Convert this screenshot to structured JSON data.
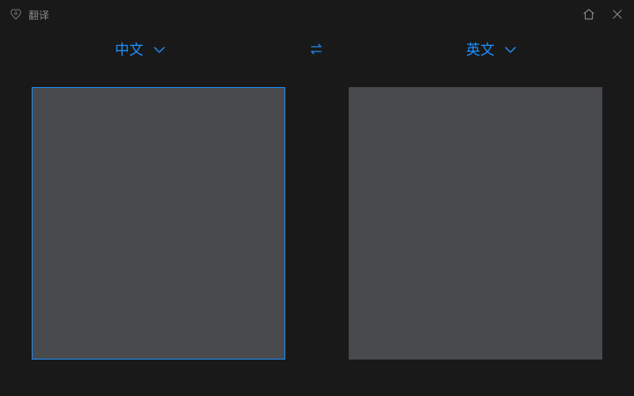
{
  "titlebar": {
    "app_title": "翻译"
  },
  "languages": {
    "source": "中文",
    "target": "英文"
  },
  "accent_color": "#1e90ff"
}
